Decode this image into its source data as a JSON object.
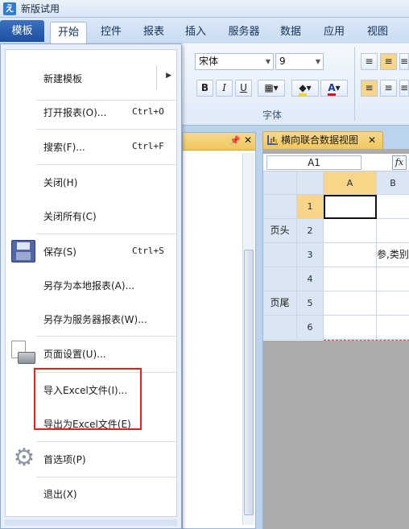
{
  "app": {
    "title": "新版试用"
  },
  "tabs": [
    {
      "label": "模板"
    },
    {
      "label": "开始"
    },
    {
      "label": "控件"
    },
    {
      "label": "报表"
    },
    {
      "label": "插入"
    },
    {
      "label": "服务器"
    },
    {
      "label": "数据"
    },
    {
      "label": "应用"
    },
    {
      "label": "视图"
    }
  ],
  "ribbon": {
    "font_name": "宋体",
    "font_size": "9",
    "font_group_label": "字体",
    "bold": "B",
    "italic": "I",
    "underline": "U"
  },
  "file_menu": {
    "items": [
      {
        "label": "新建模板",
        "shortcut": "",
        "submenu": true
      },
      {
        "label": "打开报表(O)...",
        "shortcut": "Ctrl+O"
      },
      {
        "label": "搜索(F)...",
        "shortcut": "Ctrl+F"
      },
      {
        "label": "关闭(H)",
        "shortcut": ""
      },
      {
        "label": "关闭所有(C)",
        "shortcut": ""
      },
      {
        "label": "保存(S)",
        "shortcut": "Ctrl+S"
      },
      {
        "label": "另存为本地报表(A)...",
        "shortcut": ""
      },
      {
        "label": "另存为服务器报表(W)...",
        "shortcut": ""
      },
      {
        "label": "页面设置(U)...",
        "shortcut": ""
      },
      {
        "label": "导入Excel文件(I)...",
        "shortcut": ""
      },
      {
        "label": "导出为Excel文件(E)",
        "shortcut": ""
      },
      {
        "label": "首选项(P)",
        "shortcut": ""
      },
      {
        "label": "退出(X)",
        "shortcut": ""
      }
    ]
  },
  "document": {
    "tab_title": "横向联合数据视图",
    "cell_ref": "A1",
    "columns": [
      "A",
      "B"
    ],
    "rows": [
      {
        "num": "1",
        "band": "",
        "b": ""
      },
      {
        "num": "2",
        "band": "页头",
        "b": ""
      },
      {
        "num": "3",
        "band": "",
        "b": "参,类别"
      },
      {
        "num": "4",
        "band": "",
        "b": ""
      },
      {
        "num": "5",
        "band": "页尾",
        "b": ""
      },
      {
        "num": "6",
        "band": "",
        "b": ""
      }
    ]
  },
  "colors": {
    "highlight": "#e5201c",
    "menu_button": "#1d4f9d",
    "selected_header": "#f9d58a"
  }
}
